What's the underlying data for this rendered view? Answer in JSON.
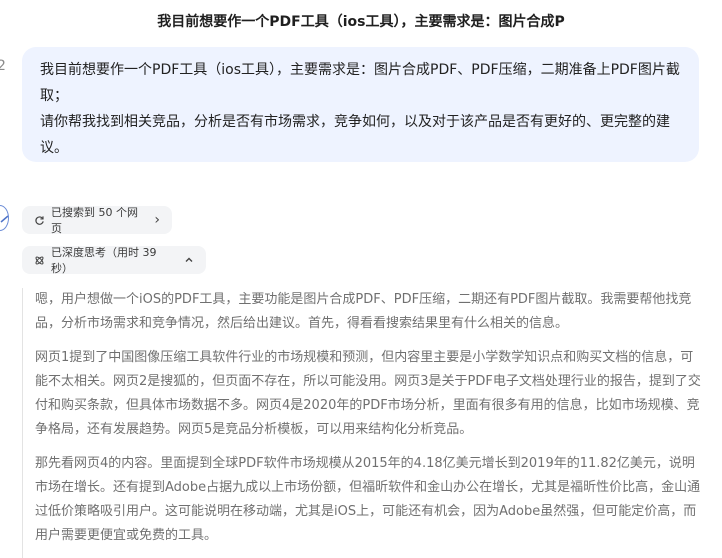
{
  "header": {
    "title": "我目前想要作一个PDF工具（ios工具），主要需求是：图片合成P"
  },
  "edge_char": "2",
  "user_message": {
    "line1": "我目前想要作一个PDF工具（ios工具），主要需求是：图片合成PDF、PDF压缩，二期准备上PDF图片截取；",
    "line2": "请你帮我找到相关竞品，分析是否有市场需求，竞争如何，以及对于该产品是否有更好的、更完整的建议。"
  },
  "search_pill": {
    "icon": "refresh-icon",
    "label": "已搜索到 50 个网页",
    "chevron": "›"
  },
  "think_pill": {
    "icon": "atom-icon",
    "label": "已深度思考（用时 39 秒）",
    "chevron": "^"
  },
  "thought": {
    "paragraphs": [
      "嗯，用户想做一个iOS的PDF工具，主要功能是图片合成PDF、PDF压缩，二期还有PDF图片截取。我需要帮他找竞品，分析市场需求和竞争情况，然后给出建议。首先，得看看搜索结果里有什么相关的信息。",
      "网页1提到了中国图像压缩工具软件行业的市场规模和预测，但内容里主要是小学数学知识点和购买文档的信息，可能不太相关。网页2是搜狐的，但页面不存在，所以可能没用。网页3是关于PDF电子文档处理行业的报告，提到了交付和购买条款，但具体市场数据不多。网页4是2020年的PDF市场分析，里面有很多有用的信息，比如市场规模、竞争格局，还有发展趋势。网页5是竞品分析模板，可以用来结构化分析竞品。",
      "那先看网页4的内容。里面提到全球PDF软件市场规模从2015年的4.18亿美元增长到2019年的11.82亿美元，说明市场在增长。还有提到Adobe占据九成以上市场份额，但福昕软件和金山办公在增长，尤其是福昕性价比高，金山通过低价策略吸引用户。这可能说明在移动端，尤其是iOS上，可能还有机会，因为Adobe虽然强，但可能定价高，而用户需要更便宜或免费的工具。"
    ]
  }
}
